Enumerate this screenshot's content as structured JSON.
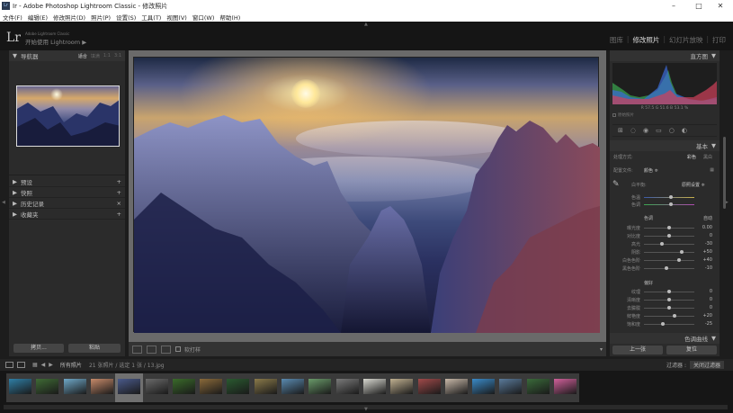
{
  "window": {
    "title": "Ir - Adobe Photoshop Lightroom Classic - 修改照片",
    "minimize": "–",
    "maximize": "□",
    "close": "✕"
  },
  "menu": [
    "文件(F)",
    "编辑(E)",
    "修改照片(D)",
    "照片(P)",
    "设置(S)",
    "工具(T)",
    "视图(V)",
    "窗口(W)",
    "帮助(H)"
  ],
  "identity": {
    "logo": "Lr",
    "small": "Adobe Lightroom Classic",
    "main": "开始使用 Lightroom",
    "arrow": "▶"
  },
  "modules": [
    {
      "label": "图库",
      "active": false
    },
    {
      "label": "修改照片",
      "active": true
    },
    {
      "label": "幻灯片放映",
      "active": false
    },
    {
      "label": "打印",
      "active": false
    }
  ],
  "left": {
    "navigator": {
      "title": "导航器",
      "fit": "适合",
      "fill": "填满",
      "one": "1:1",
      "ratio": "3:1"
    },
    "sections": [
      "预设",
      "快照",
      "历史记录",
      "收藏夹"
    ],
    "copy_button": "拷贝...",
    "paste_button": "粘贴"
  },
  "toolbar": {
    "flag_label": "软打样"
  },
  "right": {
    "histogram": {
      "title": "直方图",
      "readout": "R 57.5  G 51.6  B 53.1 %",
      "original": "原始照片"
    },
    "basic": {
      "title": "基本",
      "treatment_label": "处理方式:",
      "treatment_color": "彩色",
      "treatment_bw": "黑白",
      "profile_label": "配置文件:",
      "profile_value": "颜色 ≑",
      "wb_label": "白平衡:",
      "wb_value": "原照设置 ≑",
      "color_temp": "色温",
      "tint": "色调",
      "tone_label": "色调",
      "auto": "自动",
      "sliders": [
        {
          "label": "曝光度",
          "value": "0.00",
          "pos": 0.5
        },
        {
          "label": "对比度",
          "value": "0",
          "pos": 0.5
        },
        {
          "label": "高光",
          "value": "-30",
          "pos": 0.35
        },
        {
          "label": "阴影",
          "value": "+50",
          "pos": 0.75
        },
        {
          "label": "白色色阶",
          "value": "+40",
          "pos": 0.7
        },
        {
          "label": "黑色色阶",
          "value": "-10",
          "pos": 0.45
        }
      ],
      "presence_label": "偏好",
      "presence": [
        {
          "label": "纹理",
          "value": "0",
          "pos": 0.5
        },
        {
          "label": "清晰度",
          "value": "0",
          "pos": 0.5
        },
        {
          "label": "去朦胧",
          "value": "0",
          "pos": 0.5
        },
        {
          "label": "鲜艳度",
          "value": "+20",
          "pos": 0.6
        },
        {
          "label": "饱和度",
          "value": "-25",
          "pos": 0.38
        }
      ],
      "tone_curve": "色调曲线"
    },
    "prev_button": "上一张",
    "reset_button": "复位"
  },
  "filmstrip_bar": {
    "source": "所有照片",
    "info": "21 张照片 / 选定 1 张 / 13.jpg",
    "filter_label": "过滤器 :",
    "filter_value": "关闭过滤器"
  },
  "thumbs": [
    {
      "c": "#2f7fa6"
    },
    {
      "c": "#3f6b35"
    },
    {
      "c": "#6fa8c8"
    },
    {
      "c": "#c78a6a"
    },
    {
      "c": "#4a5a8a",
      "sel": true
    },
    {
      "c": "#6a6a6a"
    },
    {
      "c": "#3a6b2a"
    },
    {
      "c": "#8a6a3a"
    },
    {
      "c": "#2a5a30"
    },
    {
      "c": "#8a7a4a"
    },
    {
      "c": "#5a8ab0"
    },
    {
      "c": "#6a9a6a"
    },
    {
      "c": "#7a7a7a"
    },
    {
      "c": "#d8d8d0"
    },
    {
      "c": "#c0b090"
    },
    {
      "c": "#a04a4a"
    },
    {
      "c": "#c8b8a8"
    },
    {
      "c": "#3a8ac8"
    },
    {
      "c": "#5a7a9a"
    },
    {
      "c": "#3a6a3a"
    },
    {
      "c": "#d0609a"
    }
  ]
}
